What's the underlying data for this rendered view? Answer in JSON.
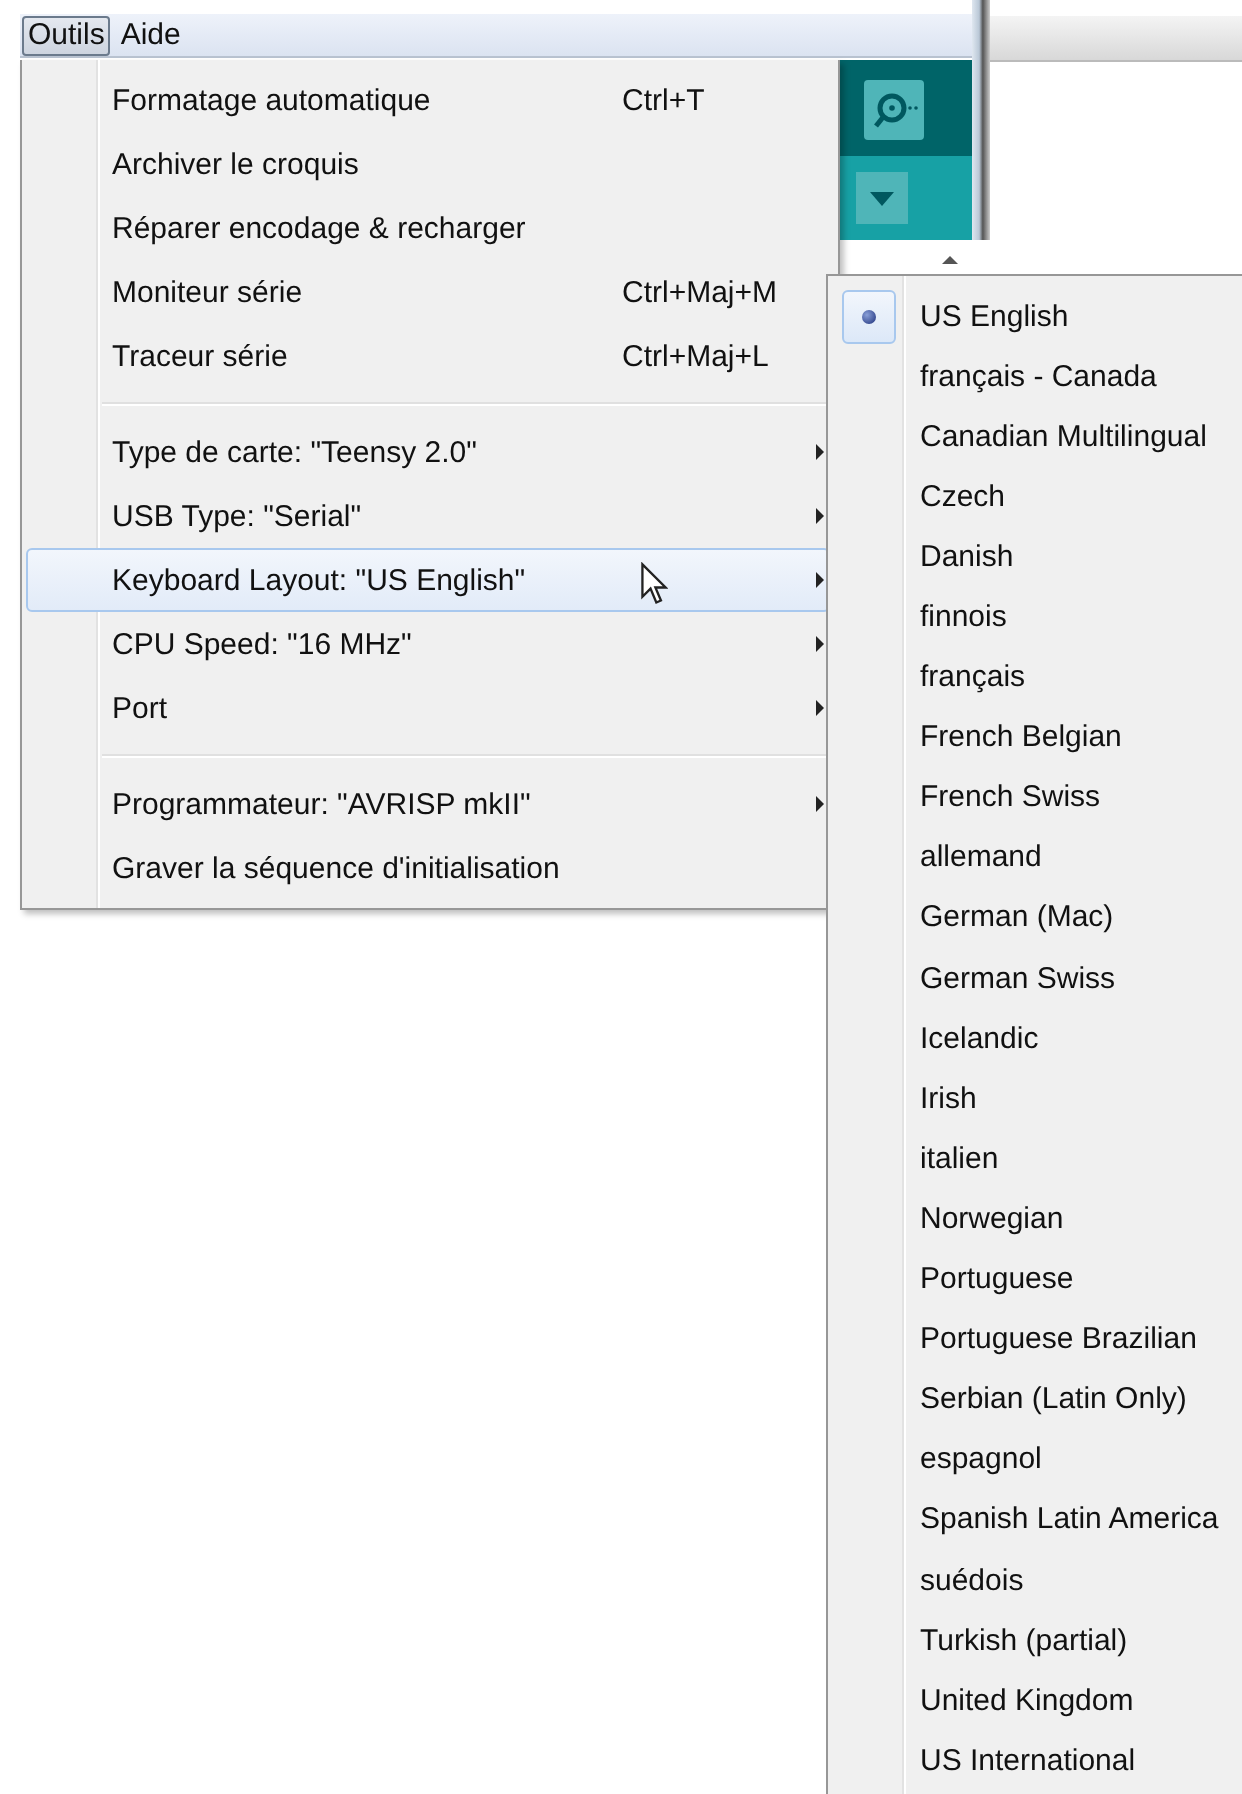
{
  "menubar": [
    {
      "label": "Outils",
      "selected": true
    },
    {
      "label": "Aide",
      "selected": false
    }
  ],
  "menu": {
    "items": [
      {
        "kind": "item",
        "label": "Formatage automatique",
        "shortcut": "Ctrl+T",
        "submenu": false,
        "selected": false
      },
      {
        "kind": "item",
        "label": "Archiver le croquis",
        "submenu": false,
        "selected": false
      },
      {
        "kind": "item",
        "label": "Réparer encodage & recharger",
        "submenu": false,
        "selected": false
      },
      {
        "kind": "item",
        "label": "Moniteur série",
        "shortcut": "Ctrl+Maj+M",
        "submenu": false,
        "selected": false
      },
      {
        "kind": "item",
        "label": "Traceur série",
        "shortcut": "Ctrl+Maj+L",
        "submenu": false,
        "selected": false
      },
      {
        "kind": "separator"
      },
      {
        "kind": "item",
        "label": "Type de carte: \"Teensy 2.0\"",
        "submenu": true,
        "selected": false
      },
      {
        "kind": "item",
        "label": "USB Type: \"Serial\"",
        "submenu": true,
        "selected": false
      },
      {
        "kind": "item",
        "label": "Keyboard Layout: \"US English\"",
        "submenu": true,
        "selected": true
      },
      {
        "kind": "item",
        "label": "CPU Speed: \"16 MHz\"",
        "submenu": true,
        "selected": false
      },
      {
        "kind": "item",
        "label": "Port",
        "submenu": true,
        "selected": false
      },
      {
        "kind": "separator"
      },
      {
        "kind": "item",
        "label": "Programmateur: \"AVRISP mkII\"",
        "submenu": true,
        "selected": false
      },
      {
        "kind": "item",
        "label": "Graver la séquence d'initialisation",
        "submenu": false,
        "selected": false
      }
    ]
  },
  "submenu": {
    "items": [
      {
        "label": "US English",
        "checked": true
      },
      {
        "label": "français  - Canada",
        "checked": false
      },
      {
        "label": "Canadian Multilingual",
        "checked": false
      },
      {
        "label": "Czech",
        "checked": false
      },
      {
        "label": "Danish",
        "checked": false
      },
      {
        "label": "finnois",
        "checked": false
      },
      {
        "label": "français",
        "checked": false
      },
      {
        "label": "French Belgian",
        "checked": false
      },
      {
        "label": "French Swiss",
        "checked": false
      },
      {
        "label": "allemand",
        "checked": false
      },
      {
        "label": "German (Mac)",
        "checked": false
      },
      {
        "label": "German Swiss",
        "checked": false
      },
      {
        "label": "Icelandic",
        "checked": false
      },
      {
        "label": "Irish",
        "checked": false
      },
      {
        "label": "italien",
        "checked": false
      },
      {
        "label": "Norwegian",
        "checked": false
      },
      {
        "label": "Portuguese",
        "checked": false
      },
      {
        "label": "Portuguese Brazilian",
        "checked": false
      },
      {
        "label": "Serbian (Latin Only)",
        "checked": false
      },
      {
        "label": "espagnol",
        "checked": false
      },
      {
        "label": "Spanish Latin America",
        "checked": false
      },
      {
        "label": "suédois",
        "checked": false
      },
      {
        "label": "Turkish (partial)",
        "checked": false
      },
      {
        "label": "United Kingdom",
        "checked": false
      },
      {
        "label": "US International",
        "checked": false
      }
    ]
  }
}
